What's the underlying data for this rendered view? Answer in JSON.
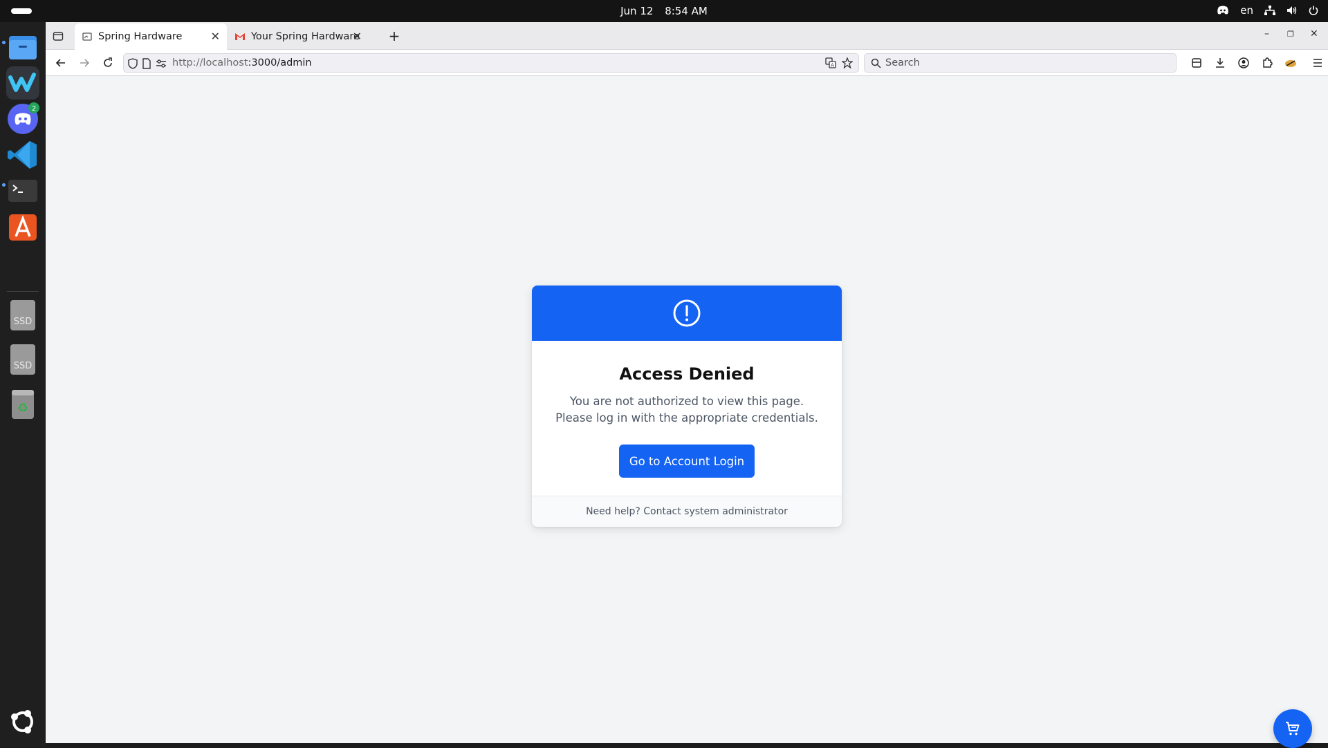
{
  "topbar": {
    "date": "Jun 12",
    "time": "8:54 AM",
    "language": "en"
  },
  "dock": {
    "items": [
      {
        "name": "files",
        "icon": "folder-icon"
      },
      {
        "name": "windsurf",
        "icon": "windsurf-icon"
      },
      {
        "name": "discord",
        "icon": "discord-icon",
        "badge": "2"
      },
      {
        "name": "vscode",
        "icon": "vscode-icon"
      },
      {
        "name": "terminal",
        "icon": "terminal-icon"
      },
      {
        "name": "app-center",
        "icon": "app-store-icon"
      },
      {
        "name": "ssd-1",
        "icon": "drive-icon",
        "label": "SSD"
      },
      {
        "name": "ssd-2",
        "icon": "drive-icon",
        "label": "SSD"
      },
      {
        "name": "trash",
        "icon": "trash-icon"
      }
    ]
  },
  "browser": {
    "tabs": [
      {
        "title": "Spring Hardware",
        "active": true
      },
      {
        "title": "Your Spring Hardware Or",
        "active": false
      }
    ],
    "url_host": "http://localhost",
    "url_rest": ":3000/admin",
    "search_placeholder": "Search"
  },
  "page": {
    "title": "Access Denied",
    "message": "You are not authorized to view this page. Please log in with the appropriate credentials.",
    "login_button": "Go to Account Login",
    "footer": "Need help? Contact system administrator"
  },
  "colors": {
    "accent": "#1463f3",
    "background": "#f3f4f6"
  }
}
